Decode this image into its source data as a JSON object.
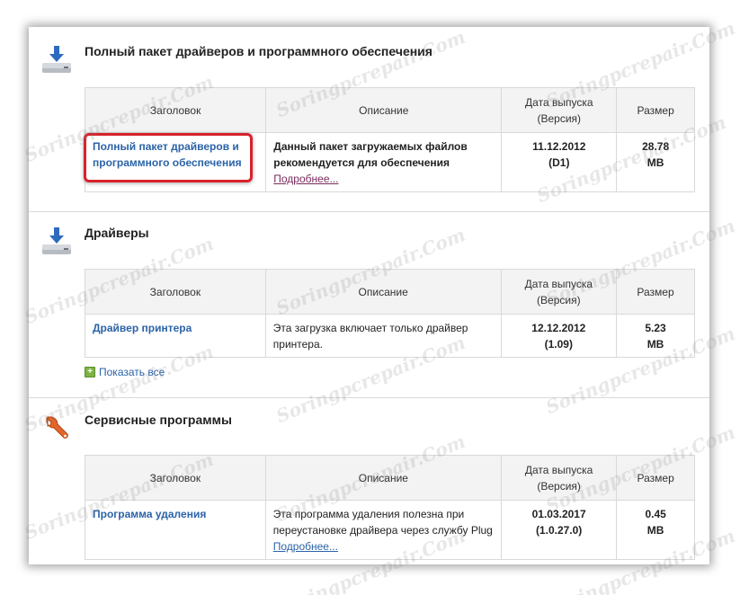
{
  "sections": [
    {
      "title": "Полный пакет драйверов и программного обеспечения",
      "icon": "download-drive-icon",
      "headers": {
        "title": "Заголовок",
        "desc": "Описание",
        "date": "Дата выпуска\n(Версия)",
        "size": "Размер"
      },
      "rows": [
        {
          "title": "Полный пакет драйверов и программного обеспечения",
          "desc": "Данный пакет загружаемых файлов рекомендуется для обеспечения",
          "more": "Подробнее...",
          "date": "11.12.2012",
          "version": "(D1)",
          "size": "28.78",
          "size_unit": "MB"
        }
      ]
    },
    {
      "title": "Драйверы",
      "icon": "download-drive-icon",
      "headers": {
        "title": "Заголовок",
        "desc": "Описание",
        "date": "Дата выпуска\n(Версия)",
        "size": "Размер"
      },
      "rows": [
        {
          "title": "Драйвер принтера",
          "desc": "Эта загрузка включает только драйвер принтера.",
          "date": "12.12.2012",
          "version": "(1.09)",
          "size": "5.23",
          "size_unit": "MB"
        }
      ],
      "show_all": "Показать все"
    },
    {
      "title": "Сервисные программы",
      "icon": "wrench-icon",
      "headers": {
        "title": "Заголовок",
        "desc": "Описание",
        "date": "Дата выпуска\n(Версия)",
        "size": "Размер"
      },
      "rows": [
        {
          "title": "Программа удаления",
          "desc": "Эта программа удаления полезна при переустановке драйвера через службу Plug",
          "more": "Подробнее...",
          "date": "01.03.2017",
          "version": "(1.0.27.0)",
          "size": "0.45",
          "size_unit": "MB"
        }
      ]
    }
  ],
  "watermark": "Soringpcrepair.Com",
  "colors": {
    "link": "#2b63a8",
    "highlight": "#d9212b",
    "header_bg": "#f3f3f3",
    "border": "#d9d9d9"
  }
}
